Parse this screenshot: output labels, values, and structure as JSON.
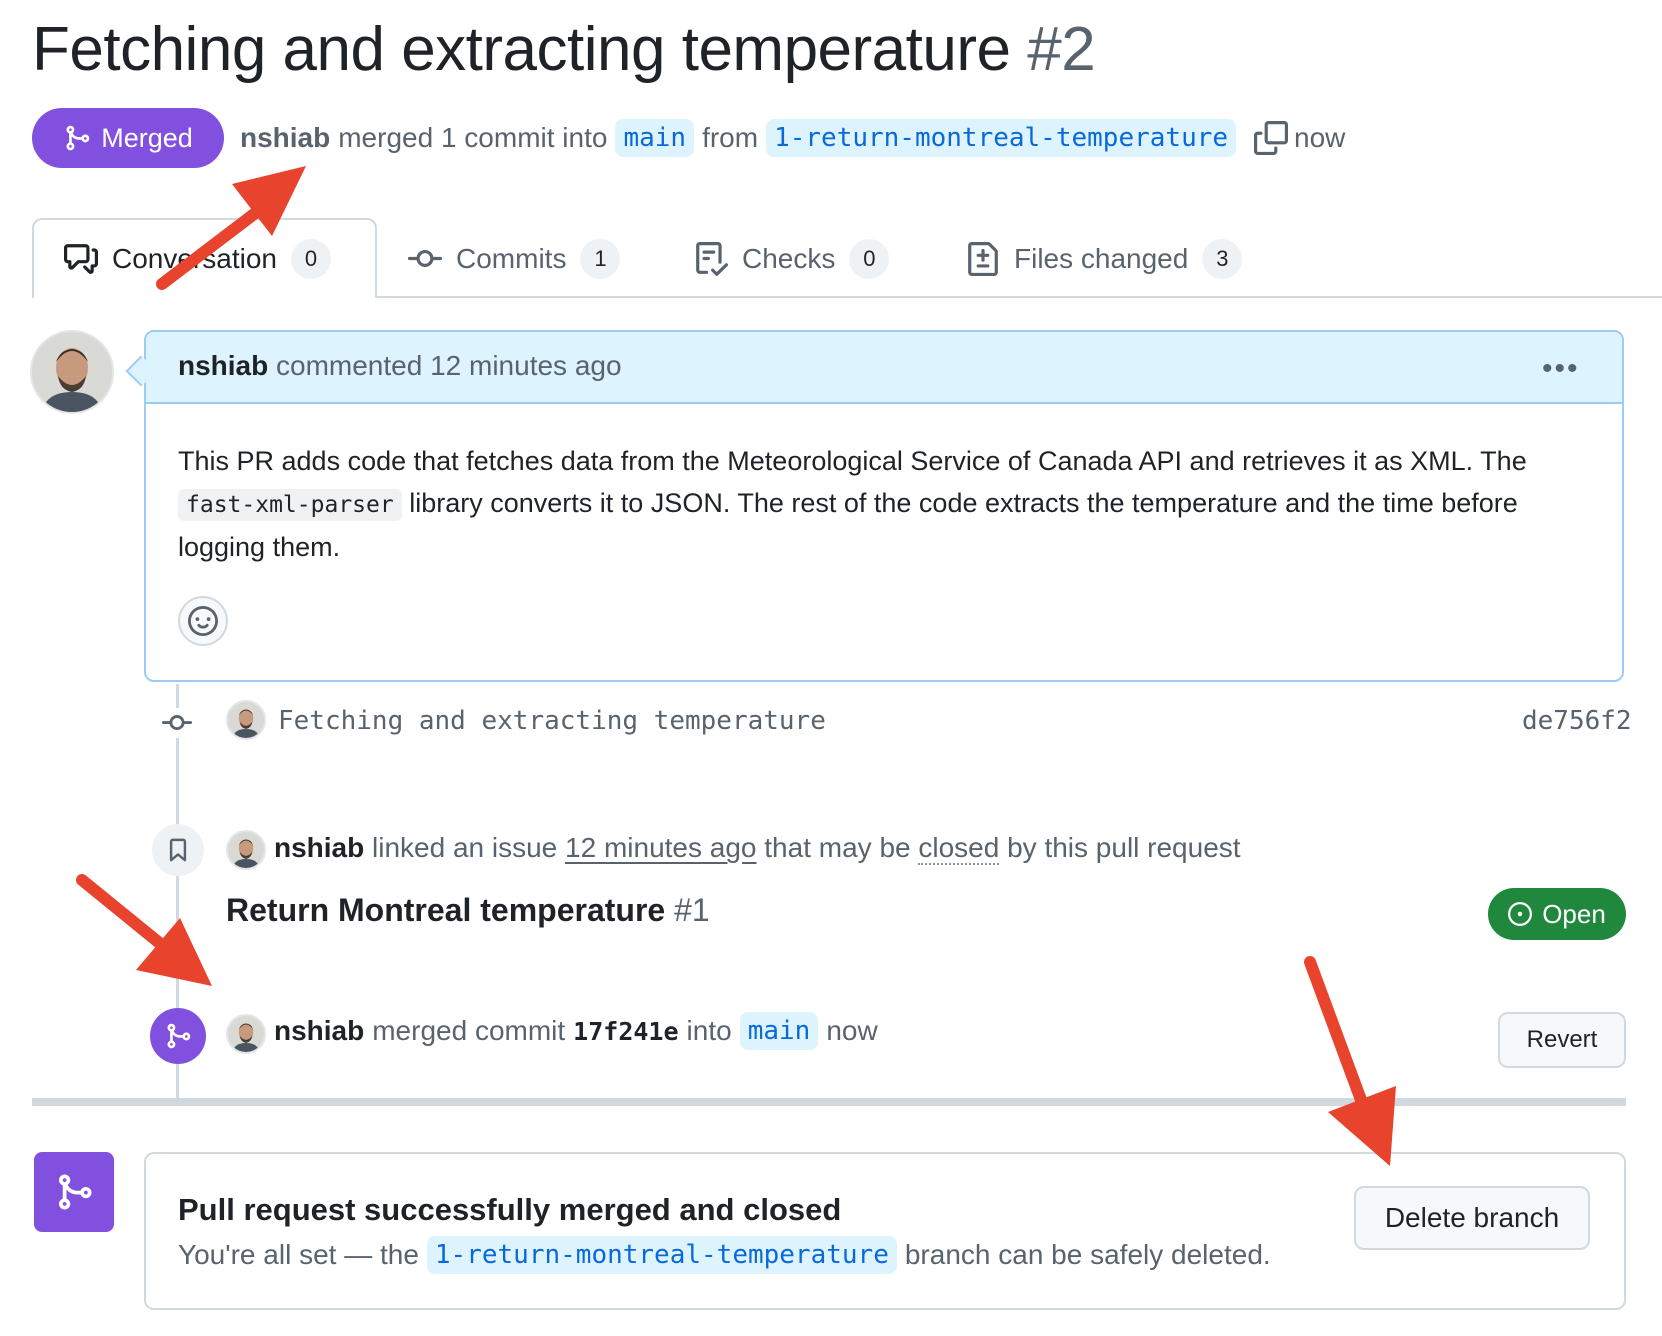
{
  "header": {
    "title": "Fetching and extracting temperature",
    "number": "#2",
    "state_badge": "Merged",
    "author": "nshiab",
    "merge_text": "merged 1 commit into",
    "base_branch": "main",
    "from_text": "from",
    "head_branch": "1-return-montreal-temperature",
    "time": "now"
  },
  "tabs": [
    {
      "label": "Conversation",
      "count": "0",
      "icon": "comment-discussion-icon"
    },
    {
      "label": "Commits",
      "count": "1",
      "icon": "git-commit-icon"
    },
    {
      "label": "Checks",
      "count": "0",
      "icon": "checklist-icon"
    },
    {
      "label": "Files changed",
      "count": "3",
      "icon": "file-diff-icon"
    }
  ],
  "comment": {
    "author": "nshiab",
    "meta": "commented 12 minutes ago",
    "body_part1": "This PR adds code that fetches data from the Meteorological Service of Canada API and retrieves it as XML. The",
    "body_code": "fast-xml-parser",
    "body_part2": "library converts it to JSON. The rest of the code extracts the temperature and the time before logging them."
  },
  "commit": {
    "message": "Fetching and extracting temperature",
    "sha": "de756f2"
  },
  "link_event": {
    "author": "nshiab",
    "text1": "linked an issue",
    "time": "12 minutes ago",
    "text2": "that may be",
    "closed": "closed",
    "text3": "by this pull request",
    "issue_title": "Return Montreal temperature",
    "issue_number": "#1",
    "issue_state": "Open"
  },
  "merge_event": {
    "author": "nshiab",
    "text1": "merged commit",
    "sha": "17f241e",
    "text2": "into",
    "branch": "main",
    "time": "now",
    "revert_label": "Revert"
  },
  "merge_box": {
    "title": "Pull request successfully merged and closed",
    "text1": "You're all set — the",
    "branch": "1-return-montreal-temperature",
    "text2": "branch can be safely deleted.",
    "delete_label": "Delete branch"
  },
  "colors": {
    "merged_purple": "#8250df",
    "open_green": "#1f883d",
    "annotation_red": "#e8432c",
    "branch_blue": "#0969da"
  }
}
